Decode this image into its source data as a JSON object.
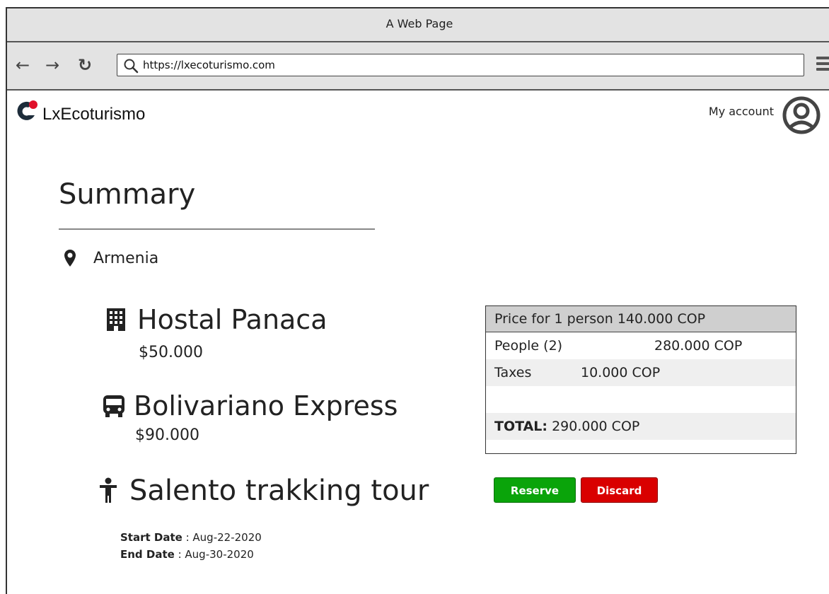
{
  "browser": {
    "title": "A Web Page",
    "url": "https://lxecoturismo.com"
  },
  "header": {
    "logo_text": "LxEcoturismo",
    "account_label": "My account"
  },
  "summary": {
    "title": "Summary",
    "location": "Armenia",
    "items": [
      {
        "icon": "building-icon",
        "name": "Hostal Panaca",
        "price": "$50.000"
      },
      {
        "icon": "bus-icon",
        "name": "Bolivariano Express",
        "price": "$90.000"
      },
      {
        "icon": "person-icon",
        "name": "Salento trakking tour"
      }
    ],
    "start_date_label": "Start Date",
    "start_date": ": Aug-22-2020",
    "end_date_label": "End Date",
    "end_date": ": Aug-30-2020"
  },
  "pricing": {
    "header": "Price for 1 person 140.000 COP",
    "people_label": "People (2)",
    "people_value": "280.000 COP",
    "taxes_label": "Taxes",
    "taxes_value": "10.000 COP",
    "total_label": "TOTAL:",
    "total_value": "290.000 COP"
  },
  "actions": {
    "reserve": "Reserve",
    "discard": "Discard"
  },
  "colors": {
    "reserve_bg": "#0aa40a",
    "discard_bg": "#d90000",
    "logo_red": "#e0102a",
    "logo_dark": "#1d2c3a"
  }
}
